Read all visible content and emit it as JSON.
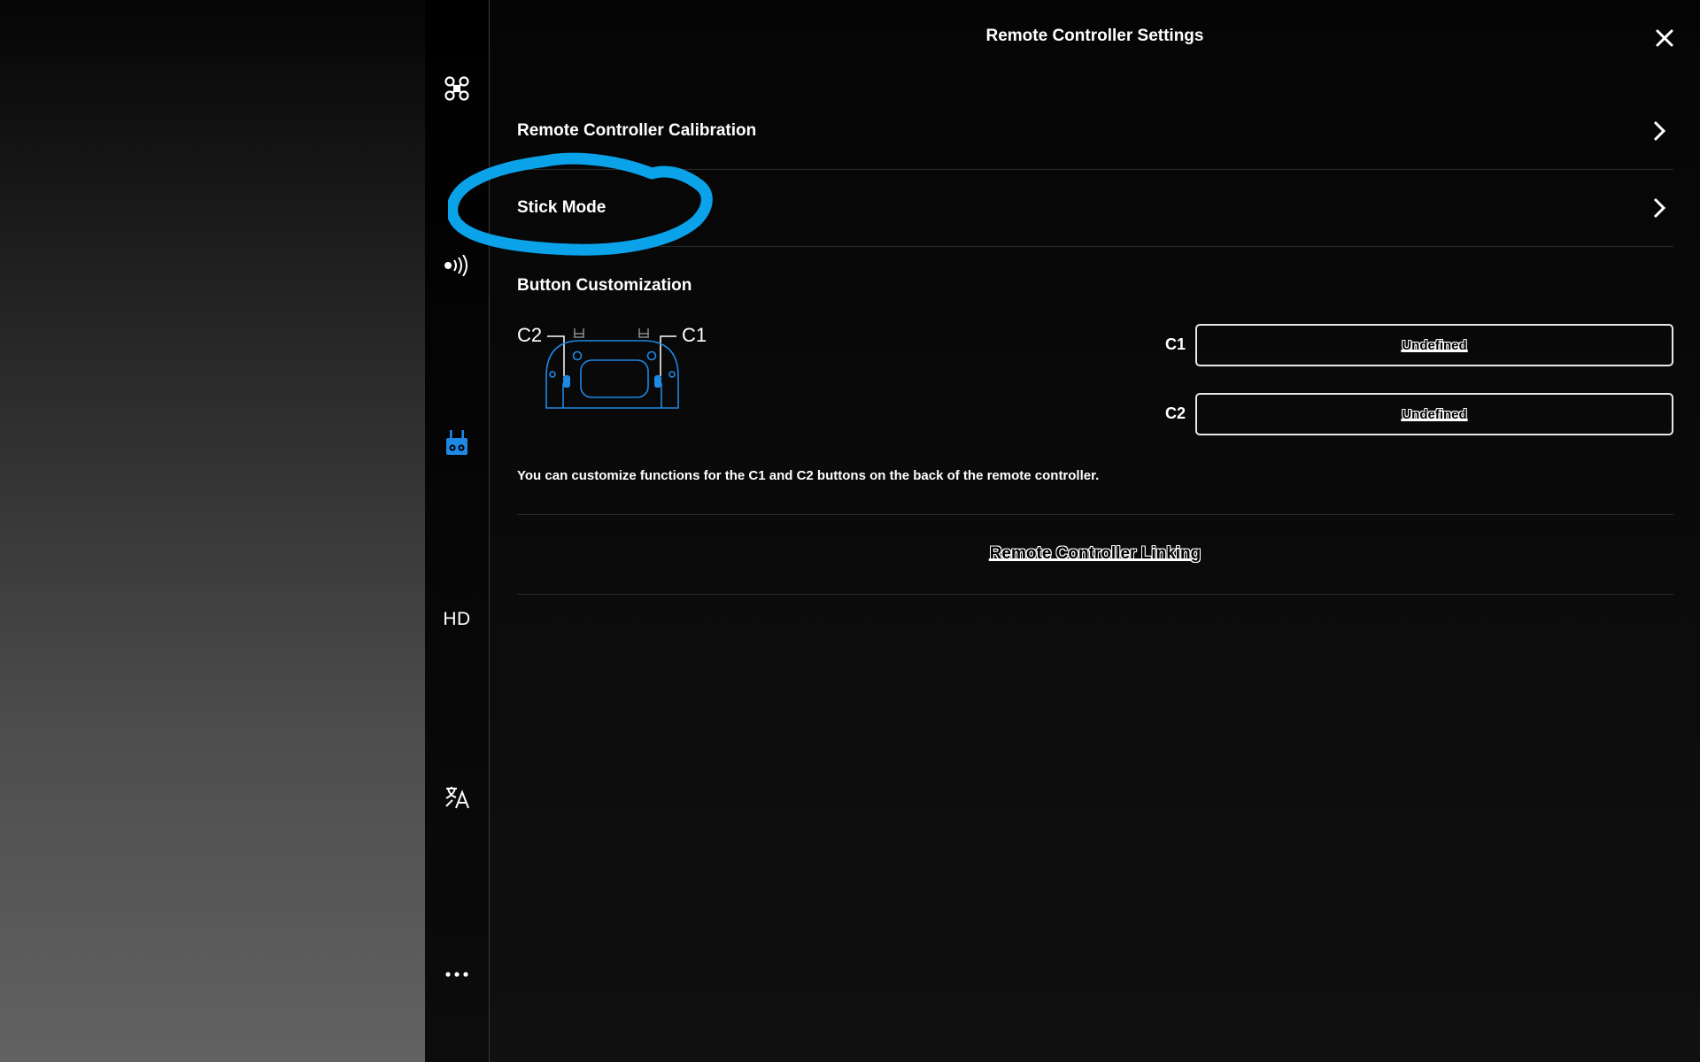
{
  "header": {
    "title": "Remote Controller Settings"
  },
  "sidebar": {
    "items": [
      {
        "name": "aircraft",
        "icon": "drone-icon",
        "active": false
      },
      {
        "name": "transmission-signal",
        "icon": "signal-icon",
        "active": false
      },
      {
        "name": "remote-controller",
        "icon": "remote-controller-icon",
        "active": true
      },
      {
        "name": "hd",
        "label": "HD",
        "active": false
      },
      {
        "name": "language",
        "icon": "translate-icon",
        "active": false
      },
      {
        "name": "more",
        "icon": "more-icon",
        "active": false
      }
    ]
  },
  "rows": {
    "calibration": "Remote Controller Calibration",
    "stick_mode": "Stick Mode"
  },
  "customization": {
    "title": "Button Customization",
    "diagram_labels": {
      "left": "C2",
      "right": "C1"
    },
    "buttons": [
      {
        "label": "C1",
        "value": "Undefined"
      },
      {
        "label": "C2",
        "value": "Undefined"
      }
    ],
    "description": "You can customize functions for the C1 and C2 buttons on the back of the remote controller."
  },
  "linking": {
    "label": "Remote Controller Linking"
  },
  "colors": {
    "accent": "#1e88e5",
    "annotation": "#0aa3ea",
    "text": "#ffffff",
    "background": "#0a0a0a"
  }
}
